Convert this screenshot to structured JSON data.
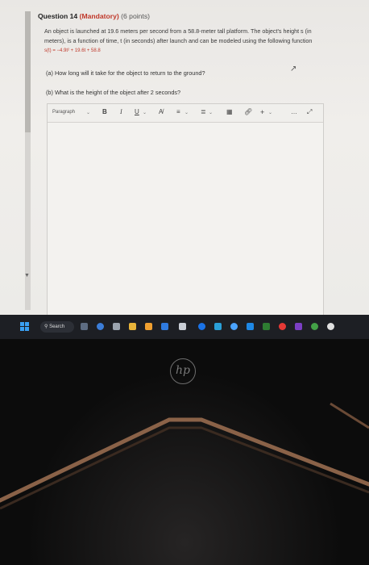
{
  "question": {
    "title": "Question 14",
    "mandatory": "(Mandatory)",
    "points": "(6 points)",
    "text": "An object is launched at 19.6 meters per second from a 58.8-meter tall platform. The object's height s (in meters), is a function of time, t (in seconds) after launch and can be modeled using the following function",
    "function": "s(t) = −4.9t² + 19.6t + 58.8",
    "part_a": "(a) How long will it take for the object to return to the ground?",
    "part_b": "(b) What is the height of the object after 2 seconds?"
  },
  "editor": {
    "paragraph_label": "Paragraph",
    "bold": "B",
    "italic": "I",
    "underline": "U",
    "more": "…"
  },
  "taskbar": {
    "search_label": "Search"
  },
  "device": {
    "logo": "hp"
  },
  "colors": {
    "mandatory": "#c0392b",
    "taskbar": "#1d1f24",
    "windows_blue": "#3aa0f2"
  }
}
